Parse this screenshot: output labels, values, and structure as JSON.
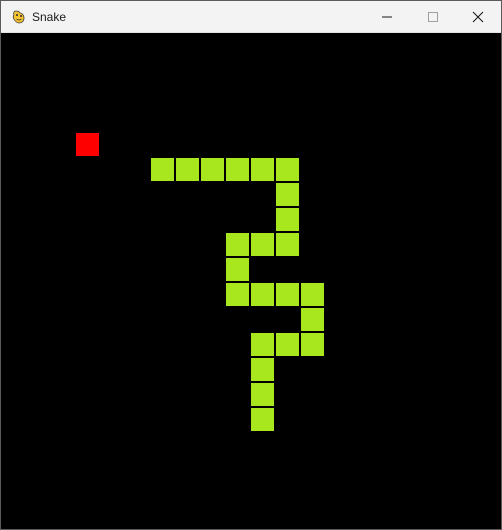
{
  "window": {
    "title": "Snake",
    "app_icon": "pygame-snake-icon",
    "controls": [
      "minimize-icon",
      "maximize-icon",
      "close-icon"
    ]
  },
  "game": {
    "background_color": "#000000",
    "snake_color": "#a8e61d",
    "food_color": "#ff0000",
    "grid_columns": 20,
    "grid_rows": 20,
    "snake": [
      [
        6,
        5
      ],
      [
        7,
        5
      ],
      [
        8,
        5
      ],
      [
        9,
        5
      ],
      [
        10,
        5
      ],
      [
        11,
        5
      ],
      [
        11,
        6
      ],
      [
        11,
        7
      ],
      [
        11,
        8
      ],
      [
        10,
        8
      ],
      [
        9,
        8
      ],
      [
        9,
        9
      ],
      [
        9,
        10
      ],
      [
        10,
        10
      ],
      [
        11,
        10
      ],
      [
        12,
        10
      ],
      [
        12,
        11
      ],
      [
        12,
        12
      ],
      [
        11,
        12
      ],
      [
        10,
        12
      ],
      [
        10,
        13
      ],
      [
        10,
        14
      ],
      [
        10,
        15
      ]
    ],
    "food": [
      3,
      4
    ]
  }
}
